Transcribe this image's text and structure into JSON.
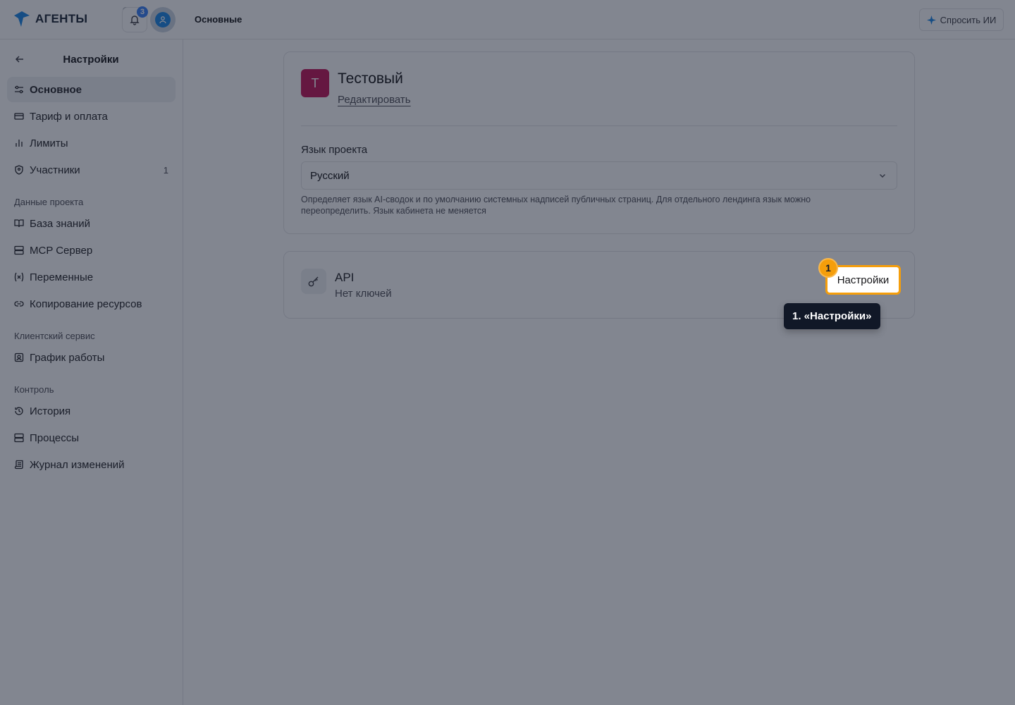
{
  "app": {
    "name": "АГЕНТЫ",
    "notifications_count": "3"
  },
  "header": {
    "breadcrumb": "Основные",
    "ask_ai_label": "Спросить ИИ"
  },
  "sidebar": {
    "title": "Настройки",
    "items_main": [
      {
        "label": "Основное",
        "icon": "sliders-icon",
        "active": true
      },
      {
        "label": "Тариф и оплата",
        "icon": "credit-card-icon"
      },
      {
        "label": "Лимиты",
        "icon": "bar-chart-icon"
      },
      {
        "label": "Участники",
        "icon": "users-icon",
        "count": "1"
      }
    ],
    "section_project": "Данные проекта",
    "items_project": [
      {
        "label": "База знаний",
        "icon": "book-icon"
      },
      {
        "label": "MCP Сервер",
        "icon": "server-icon"
      },
      {
        "label": "Переменные",
        "icon": "variable-icon"
      },
      {
        "label": "Копирование ресурсов",
        "icon": "link-icon"
      }
    ],
    "section_client": "Клиентский сервис",
    "items_client": [
      {
        "label": "График работы",
        "icon": "schedule-icon"
      }
    ],
    "section_control": "Контроль",
    "items_control": [
      {
        "label": "История",
        "icon": "history-icon"
      },
      {
        "label": "Процессы",
        "icon": "server-icon"
      },
      {
        "label": "Журнал изменений",
        "icon": "scroll-icon"
      }
    ]
  },
  "project": {
    "avatar_letter": "Т",
    "name": "Тестовый",
    "edit_label": "Редактировать",
    "language_label": "Язык проекта",
    "language_value": "Русский",
    "language_hint": "Определяет язык AI-сводок и по умолчанию системных надписей публичных страниц. Для отдельного лендинга язык можно переопределить. Язык кабинета не меняется"
  },
  "api": {
    "title": "API",
    "subtitle": "Нет ключей",
    "settings_label": "Настройки"
  },
  "highlight": {
    "number": "1",
    "tooltip": "1. «Настройки»",
    "accent_color": "#f59e0b"
  }
}
